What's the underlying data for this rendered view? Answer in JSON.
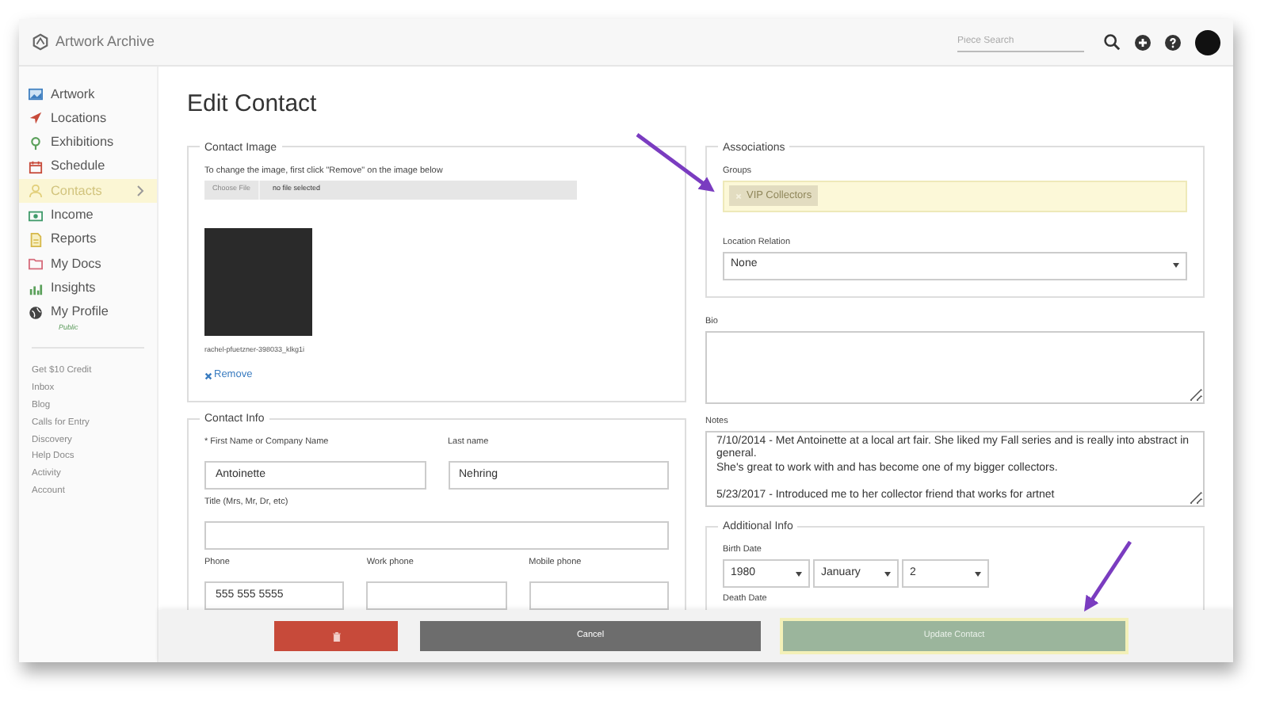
{
  "app": {
    "name": "Artwork Archive"
  },
  "header": {
    "search": {
      "placeholder": "Piece Search"
    }
  },
  "sidebar": {
    "items": [
      {
        "label": "Artwork",
        "selected": false
      },
      {
        "label": "Locations",
        "selected": false
      },
      {
        "label": "Exhibitions",
        "selected": false
      },
      {
        "label": "Schedule",
        "selected": false
      },
      {
        "label": "Contacts",
        "selected": true
      },
      {
        "label": "Income",
        "selected": false
      },
      {
        "label": "Reports",
        "selected": false
      },
      {
        "label": "My Docs",
        "selected": false
      },
      {
        "label": "Insights",
        "selected": false
      },
      {
        "label": "My Profile",
        "selected": false,
        "sublabel": "Public"
      }
    ],
    "links": [
      "Get $10 Credit",
      "Inbox",
      "Blog",
      "Calls for Entry",
      "Discovery",
      "Help Docs",
      "Activity",
      "Account"
    ]
  },
  "page": {
    "title": "Edit Contact"
  },
  "contact_image": {
    "legend": "Contact Image",
    "hint": "To change the image, first click \"Remove\" on the image below",
    "file_button": "Choose File",
    "file_status": "no file selected",
    "filename": "rachel-pfuetzner-398033_klkg1i",
    "remove": "Remove"
  },
  "contact_info": {
    "legend": "Contact Info",
    "rows": [
      [
        {
          "label": "* First Name or Company Name",
          "value": "Antoinette"
        },
        {
          "label": "Last name",
          "value": "Nehring"
        }
      ],
      [
        {
          "label": "Title (Mrs, Mr, Dr, etc)"
        }
      ],
      [
        {
          "label": "Phone",
          "value": "555 555 5555"
        },
        {
          "label": "Work phone"
        },
        {
          "label": "Mobile phone"
        }
      ]
    ]
  },
  "associations": {
    "legend": "Associations",
    "groups": {
      "label": "Groups",
      "tags": [
        "VIP Collectors"
      ]
    },
    "location_relation": {
      "label": "Location Relation",
      "value": "None"
    }
  },
  "bio": {
    "label": "Bio"
  },
  "notes": {
    "label": "Notes",
    "value": "7/10/2014 - Met Antoinette at a local art fair. She liked my Fall series and is really into abstract in general.\nShe's great to work with and has become one of my bigger collectors.\n\n5/23/2017 - Introduced me to her collector friend that works for artnet"
  },
  "additional_info": {
    "legend": "Additional Info",
    "birth_date": {
      "label": "Birth Date",
      "year": "1980",
      "month": "January",
      "day": "2"
    },
    "death_date": {
      "label": "Death Date"
    }
  },
  "footer": {
    "buttons": [
      {
        "kind": "delete"
      },
      {
        "kind": "cancel",
        "label": "Cancel"
      },
      {
        "kind": "submit",
        "label": "Update Contact"
      }
    ]
  }
}
